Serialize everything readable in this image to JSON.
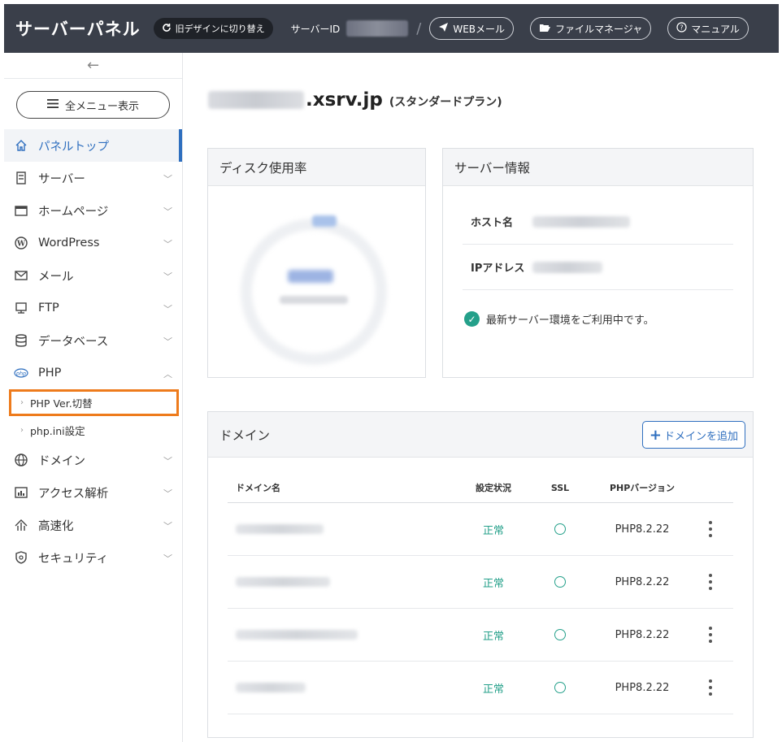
{
  "header": {
    "title": "サーバーパネル",
    "old_design": "旧デザインに切り替え",
    "server_id_label": "サーバーID",
    "separator": "/",
    "links": [
      {
        "label": "WEBメール",
        "icon": "paper-plane-icon"
      },
      {
        "label": "ファイルマネージャ",
        "icon": "folder-open-icon"
      },
      {
        "label": "マニュアル",
        "icon": "question-circle-icon"
      }
    ]
  },
  "sidebar": {
    "collapse_icon": "←",
    "all_menu": "全メニュー表示",
    "items": [
      {
        "label": "パネルトップ",
        "icon": "home-icon",
        "active": true
      },
      {
        "label": "サーバー",
        "icon": "server-icon"
      },
      {
        "label": "ホームページ",
        "icon": "browser-window-icon"
      },
      {
        "label": "WordPress",
        "icon": "wordpress-icon"
      },
      {
        "label": "メール",
        "icon": "envelope-icon"
      },
      {
        "label": "FTP",
        "icon": "monitor-icon"
      },
      {
        "label": "データベース",
        "icon": "database-icon"
      },
      {
        "label": "PHP",
        "icon": "php-icon",
        "expanded": true
      },
      {
        "label": "ドメイン",
        "icon": "globe-icon"
      },
      {
        "label": "アクセス解析",
        "icon": "bar-chart-icon"
      },
      {
        "label": "高速化",
        "icon": "speed-icon"
      },
      {
        "label": "セキュリティ",
        "icon": "shield-icon"
      }
    ],
    "php_sub": [
      {
        "label": "PHP Ver.切替",
        "highlighted": true
      },
      {
        "label": "php.ini設定"
      }
    ]
  },
  "main": {
    "domain_suffix": ".xsrv.jp",
    "plan": "(スタンダードプラン)",
    "disk_title": "ディスク使用率",
    "server_info_title": "サーバー情報",
    "host_label": "ホスト名",
    "ip_label": "IPアドレス",
    "status_text": "最新サーバー環境をご利用中です。",
    "domain_card_title": "ドメイン",
    "add_domain": "ドメインを追加",
    "table": {
      "headers": [
        "ドメイン名",
        "設定状況",
        "SSL",
        "PHPバージョン"
      ],
      "rows": [
        {
          "status": "正常",
          "ssl": "○",
          "php": "PHP8.2.22"
        },
        {
          "status": "正常",
          "ssl": "○",
          "php": "PHP8.2.22"
        },
        {
          "status": "正常",
          "ssl": "○",
          "php": "PHP8.2.22"
        },
        {
          "status": "正常",
          "ssl": "○",
          "php": "PHP8.2.22"
        }
      ]
    }
  },
  "colors": {
    "header_bg": "#3a3f4a",
    "accent": "#2f6fbf",
    "ok": "#24a08a",
    "highlight": "#ee7b1c"
  }
}
